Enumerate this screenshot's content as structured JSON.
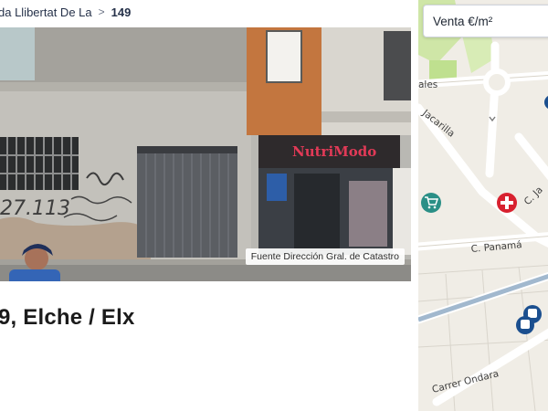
{
  "breadcrumb": {
    "parent_label": "da Llibertat De La",
    "separator": ">",
    "current_label": "149"
  },
  "photo": {
    "credit": "Fuente Dirección Gral. de Catastro",
    "shop_sign": "NutriModo",
    "wall_graffiti": "27.113"
  },
  "listing": {
    "address_title": "9, Elche / Elx"
  },
  "map": {
    "price_layer_select": "Venta €/m²",
    "street_labels": {
      "jacarilla": "Jacarilla",
      "c_ja": "C. Ja",
      "panama": "C. Panamá",
      "ondara": "Carrer Ondara",
      "ales": "ales"
    },
    "pois": [
      {
        "icon": "shopping-cart-icon",
        "color": "#2a8f86"
      },
      {
        "icon": "medical-cross-icon",
        "color": "#d8212f"
      },
      {
        "icon": "bus-stop-icon",
        "color": "#1b4f8f"
      }
    ]
  }
}
